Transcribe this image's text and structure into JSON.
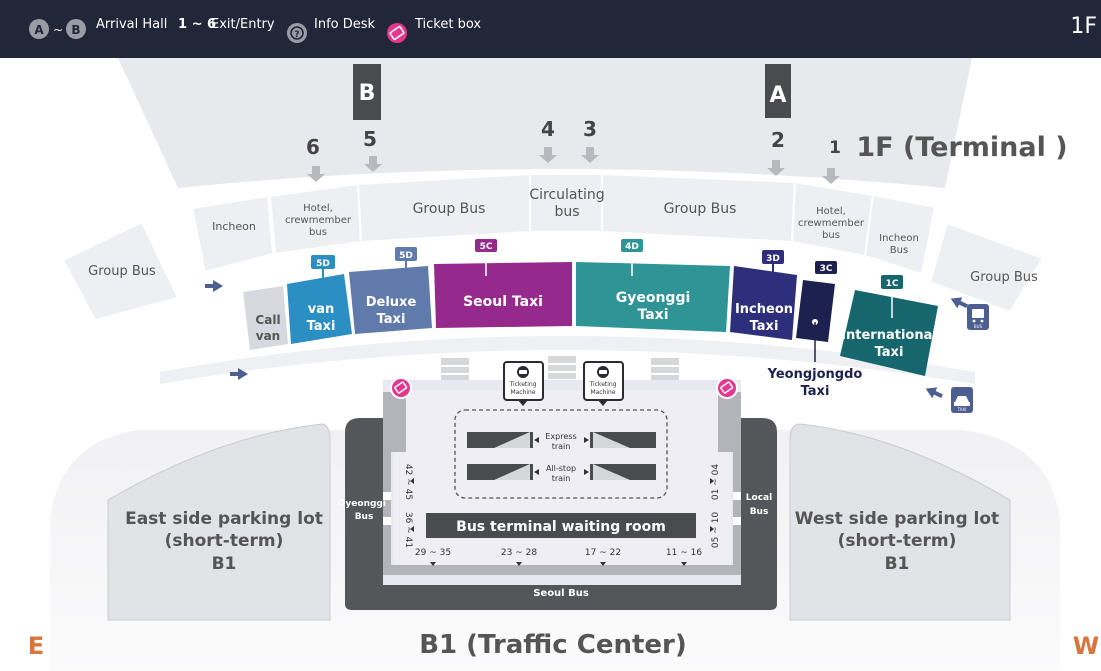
{
  "legend": {
    "circle_a": "A",
    "range_sep": "~",
    "circle_b": "B",
    "arrival_hall": "Arrival Hall",
    "exit_range": "1 ~ 6",
    "exit_entry": "Exit/Entry",
    "info_symbol": "?",
    "info_desk": "Info Desk",
    "ticket_box": "Ticket box",
    "floor": "1F"
  },
  "terminal": {
    "title": "1F (Terminal )",
    "gate_a": "A",
    "gate_b": "B",
    "exits": [
      "1",
      "2",
      "3",
      "4",
      "5",
      "6"
    ]
  },
  "zones": {
    "group_bus_left": "Group Bus",
    "incheon_left": "Incheon",
    "hotel_left": [
      "Hotel,",
      "crewmember",
      "bus"
    ],
    "group_bus_mid_left": "Group Bus",
    "circulating": [
      "Circulating",
      "bus"
    ],
    "group_bus_mid_right": "Group Bus",
    "hotel_right": [
      "Hotel,",
      "crewmember",
      "bus"
    ],
    "incheon_right": [
      "Incheon",
      "Bus"
    ],
    "group_bus_right": "Group Bus"
  },
  "taxis": [
    {
      "code": "5D",
      "lines": [
        "van",
        "Taxi"
      ]
    },
    {
      "code": "5D",
      "lines": [
        "Deluxe",
        "Taxi"
      ]
    },
    {
      "code": "5C",
      "lines": [
        "Seoul Taxi"
      ]
    },
    {
      "code": "4D",
      "lines": [
        "Gyeonggi",
        "Taxi"
      ]
    },
    {
      "code": "3D",
      "lines": [
        "Incheon",
        "Taxi"
      ]
    },
    {
      "code": "3C",
      "lines": []
    },
    {
      "code": "1C",
      "lines": [
        "International",
        "Taxi"
      ]
    }
  ],
  "call_van": [
    "Call",
    "van"
  ],
  "yeongjongdo": [
    "Yeongjongdo",
    "Taxi"
  ],
  "icons": {
    "bus": "bus-sign-icon",
    "taxi": "taxi-sign-icon",
    "ticketing": "ticketing-machine-icon",
    "ticket_box": "ticket-box-icon",
    "exit_arrow": "down-arrow-icon",
    "direction_arrow": "direction-arrow-icon"
  },
  "bus_sign_label": "BUS",
  "taxi_sign_label": "TAXI",
  "ticketing_machine": [
    "Ticketing",
    "Machine"
  ],
  "train": {
    "express": [
      "Express",
      "train"
    ],
    "all_stop": [
      "All-stop",
      "train"
    ]
  },
  "center": {
    "waiting_room": "Bus terminal waiting room",
    "gyeonggi_bus": [
      "Gyeonggi",
      "Bus"
    ],
    "local_bus": [
      "Local",
      "Bus"
    ],
    "seoul_bus": "Seoul Bus",
    "stops_left": [
      "42 ~ 45",
      "36 ~ 41"
    ],
    "stops_right": [
      "01 ~ 04",
      "05 ~ 10"
    ],
    "stops_bottom": [
      "29 ~ 35",
      "23 ~ 28",
      "17 ~ 22",
      "11 ~ 16"
    ]
  },
  "parking": {
    "east": [
      "East side parking lot",
      "(short-term)",
      "B1"
    ],
    "west": [
      "West side parking lot",
      "(short-term)",
      "B1"
    ]
  },
  "b1_title": "B1 (Traffic Center)",
  "compass": {
    "east": "E",
    "west": "W"
  },
  "colors": {
    "legend_bg": "#212638",
    "van_taxi": "#2b8fc4",
    "deluxe_taxi": "#607bab",
    "seoul_taxi": "#962a8c",
    "gyeonggi_taxi": "#2e9496",
    "incheon_taxi": "#2d2f7c",
    "yeongjongdo_taxi": "#1d2150",
    "international_taxi": "#16676d",
    "ticket_box": "#e4378f",
    "compass": "#d9763f"
  }
}
